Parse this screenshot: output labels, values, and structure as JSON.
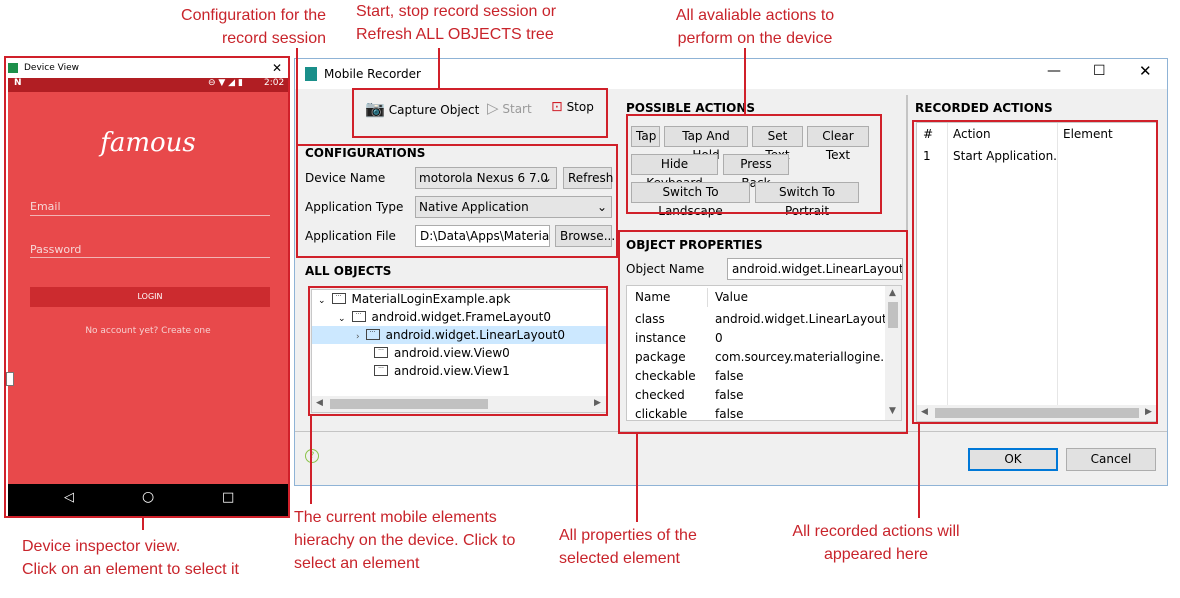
{
  "annotations": {
    "config": [
      "Configuration for the",
      "record session"
    ],
    "session": [
      "Start, stop record session or",
      "Refresh ALL OBJECTS tree"
    ],
    "actions": [
      "All avaliable actions to",
      "perform on the device"
    ],
    "inspector": [
      "Device inspector view.",
      "Click on an element to select it"
    ],
    "hierarchy": [
      "The current mobile elements",
      "hierachy on the device. Click to",
      "select an element"
    ],
    "properties": [
      "All properties of the",
      "selected element"
    ],
    "recorded": [
      "All recorded actions will",
      "appeared here"
    ]
  },
  "device": {
    "title": "Device View",
    "status_time": "2:02",
    "app_logo": "famous",
    "email_label": "Email",
    "password_label": "Password",
    "login_button": "LOGIN",
    "signup_link": "No account yet? Create one"
  },
  "window": {
    "title": "Mobile Recorder",
    "toolbar": {
      "capture": "Capture Object",
      "start": "Start",
      "stop": "Stop"
    },
    "configurations": {
      "title": "CONFIGURATIONS",
      "device_name_label": "Device Name",
      "device_name_value": "motorola Nexus 6 7.0",
      "refresh_button": "Refresh",
      "app_type_label": "Application Type",
      "app_type_value": "Native Application",
      "app_file_label": "Application File",
      "app_file_value": "D:\\Data\\Apps\\MaterialL",
      "browse_button": "Browse..."
    },
    "all_objects": {
      "title": "ALL OBJECTS",
      "tree": [
        {
          "label": "MaterialLoginExample.apk"
        },
        {
          "label": "android.widget.FrameLayout0"
        },
        {
          "label": "android.widget.LinearLayout0"
        },
        {
          "label": "android.view.View0"
        },
        {
          "label": "android.view.View1"
        }
      ]
    },
    "possible_actions": {
      "title": "POSSIBLE ACTIONS",
      "buttons": [
        "Tap",
        "Tap And Hold",
        "Set Text",
        "Clear Text",
        "Hide Keyboard",
        "Press Back",
        "Switch To Landscape",
        "Switch To Portrait"
      ]
    },
    "object_properties": {
      "title": "OBJECT PROPERTIES",
      "object_name_label": "Object Name",
      "object_name_value": "android.widget.LinearLayout0",
      "columns": [
        "Name",
        "Value"
      ],
      "rows": [
        [
          "class",
          "android.widget.LinearLayout"
        ],
        [
          "instance",
          "0"
        ],
        [
          "package",
          "com.sourcey.materiallogine..."
        ],
        [
          "checkable",
          "false"
        ],
        [
          "checked",
          "false"
        ],
        [
          "clickable",
          "false"
        ]
      ]
    },
    "recorded_actions": {
      "title": "RECORDED ACTIONS",
      "columns": [
        "#",
        "Action",
        "Element"
      ],
      "rows": [
        [
          "1",
          "Start Application...",
          ""
        ]
      ]
    },
    "ok_button": "OK",
    "cancel_button": "Cancel"
  },
  "colors": {
    "annotation_red": "#d0202a",
    "device_bg": "#e8494b",
    "selection": "#cce8ff"
  }
}
